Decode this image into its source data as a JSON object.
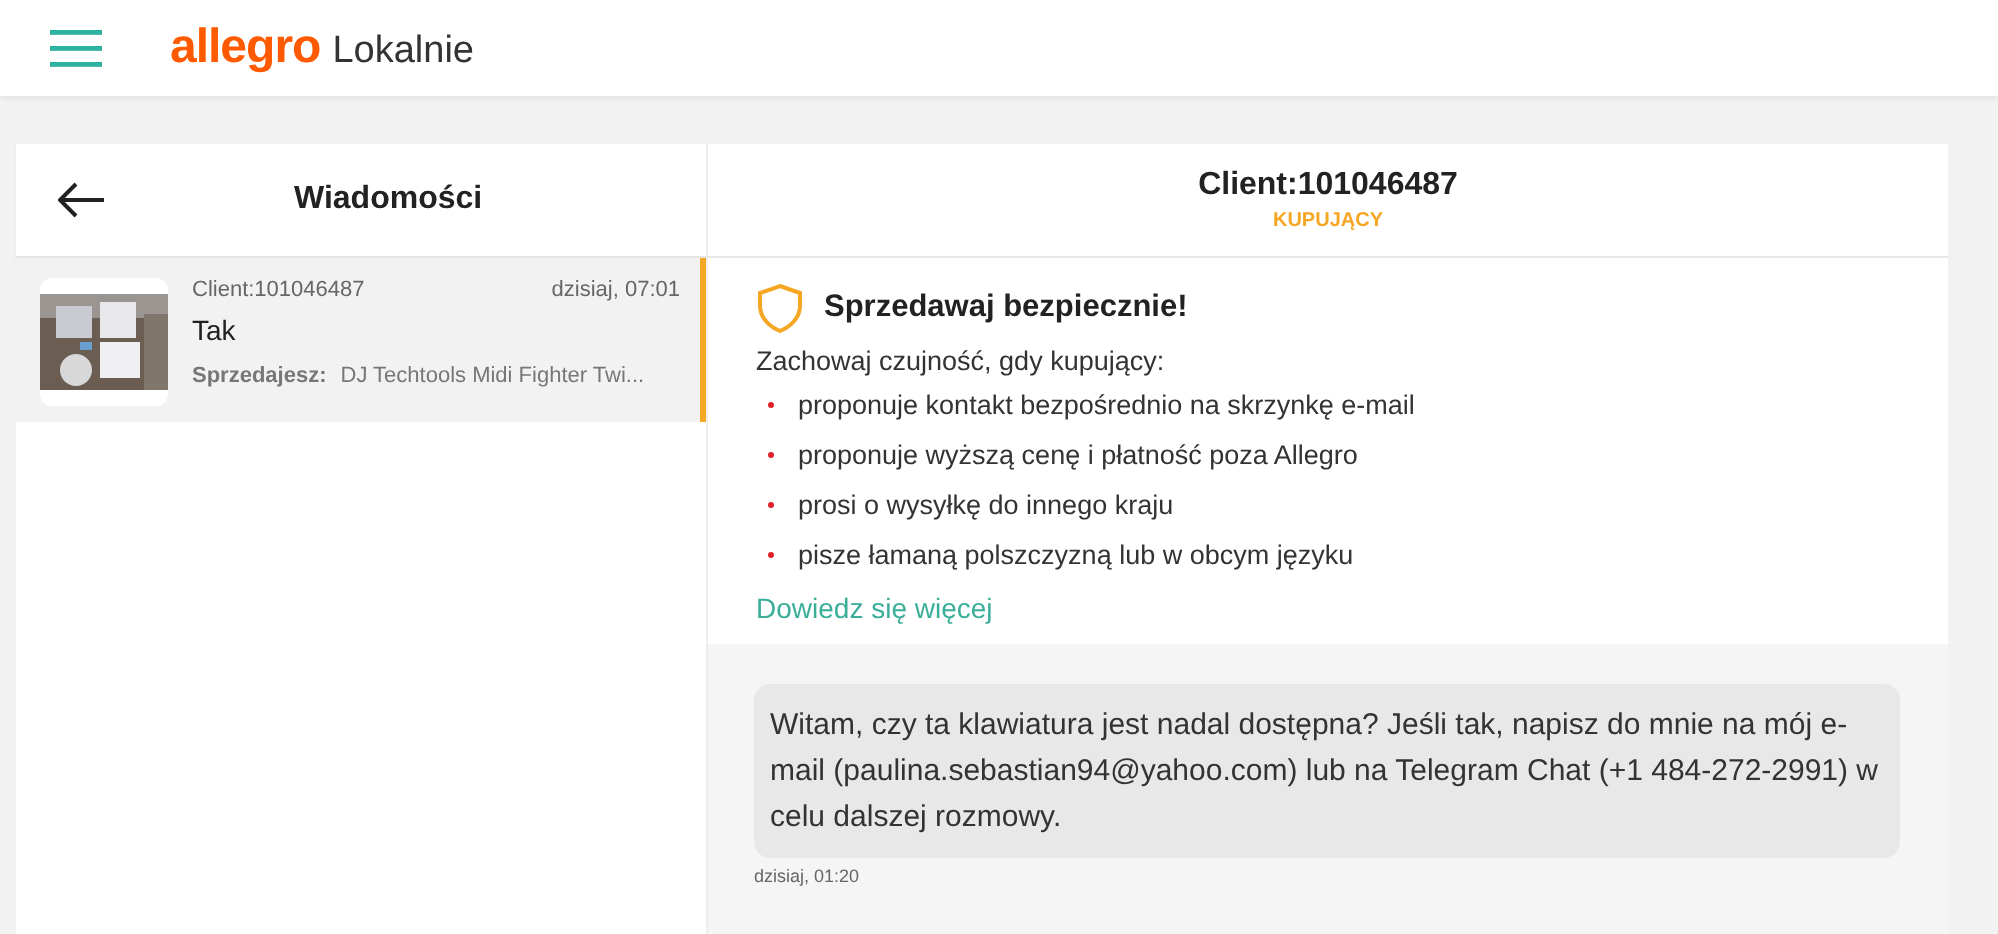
{
  "header": {
    "logo_brand": "allegro",
    "logo_product": "Lokalnie"
  },
  "sidebar": {
    "title": "Wiadomości",
    "conversations": [
      {
        "client": "Client:101046487",
        "time": "dzisiaj, 07:01",
        "last_message": "Tak",
        "seller_label": "Sprzedajesz:",
        "item": "DJ Techtools Midi Fighter Twi...",
        "selected": true
      }
    ]
  },
  "chat": {
    "title": "Client:101046487",
    "role": "KUPUJĄCY",
    "safety": {
      "title": "Sprzedawaj bezpiecznie!",
      "intro": "Zachowaj czujność, gdy kupujący:",
      "bullets": [
        "proponuje kontakt bezpośrednio na skrzynkę e-mail",
        "proponuje wyższą cenę i płatność poza Allegro",
        "prosi o wysyłkę do innego kraju",
        "pisze łamaną polszczyzną lub w obcym języku"
      ],
      "link": "Dowiedz się więcej"
    },
    "messages": [
      {
        "text": "Witam, czy ta klawiatura jest nadal dostępna? Jeśli tak, napisz do mnie na mój e-mail (paulina.sebastian94@yahoo.com) lub na Telegram Chat (+1 484-272-2991) w celu dalszej rozmowy.",
        "time": "dzisiaj, 01:20"
      }
    ]
  }
}
